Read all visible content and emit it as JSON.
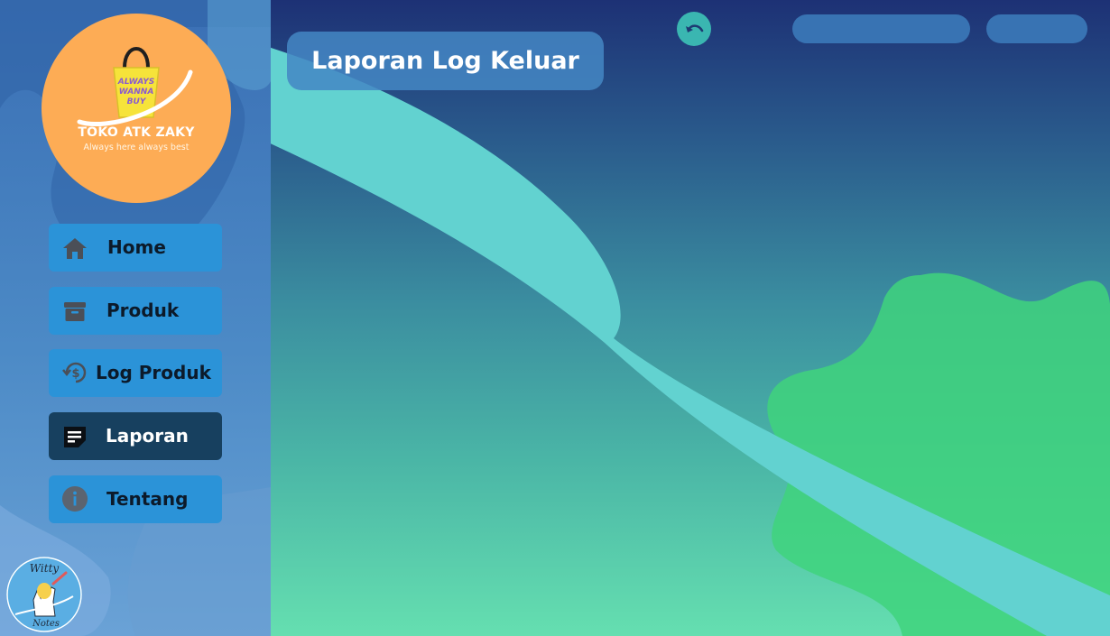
{
  "app": {
    "logo_title": "TOKO ATK ZAKY",
    "logo_subtitle": "Always here always best",
    "logo_bag_text": "ALWAYS WANNA BUY"
  },
  "header": {
    "title": "Laporan Log Keluar",
    "back_icon": "undo-arrow-icon"
  },
  "sidebar": {
    "items": [
      {
        "label": "Home",
        "icon": "home-icon",
        "active": false
      },
      {
        "label": "Produk",
        "icon": "archive-box-icon",
        "active": false
      },
      {
        "label": "Log Produk",
        "icon": "money-history-icon",
        "active": false
      },
      {
        "label": "Laporan",
        "icon": "note-icon",
        "active": true
      },
      {
        "label": "Tentang",
        "icon": "info-icon",
        "active": false
      }
    ]
  },
  "footer_logo": {
    "text_top": "Witty",
    "text_bottom": "Notes"
  },
  "colors": {
    "logo_bg": "#fdac55",
    "nav_button": "#2b93d8",
    "nav_active": "#17405f",
    "accent_teal": "#3ab6b1",
    "ribbon": "#62d2d0",
    "blob_green": "#3fd47c"
  }
}
